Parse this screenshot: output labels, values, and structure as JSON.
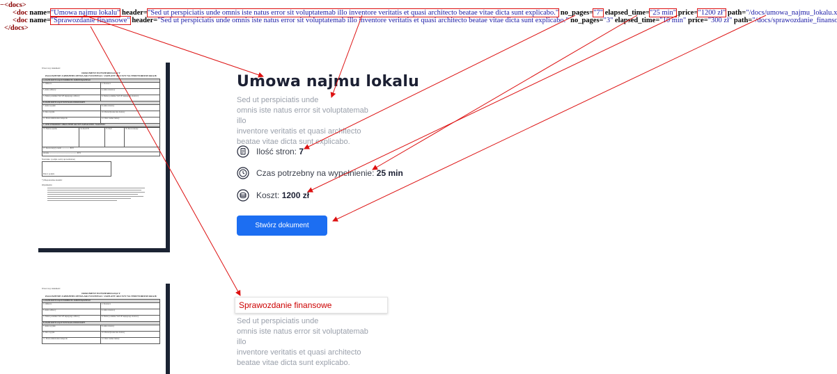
{
  "xml": {
    "minus": "−",
    "root_open": "<docs>",
    "root_close": "</docs>",
    "doc1": {
      "open": "<doc",
      "name_key": "name=",
      "name_val": "\"Umowa najmu lokalu\"",
      "header_key": "header=",
      "header_val": "\"Sed ut perspiciatis unde omnis iste natus error sit voluptatemab illo inventore veritatis et quasi architecto beatae vitae dicta sunt explicabo.\"",
      "pages_key": "no_pages=",
      "pages_val": "\"7\"",
      "time_key": "elapsed_time=",
      "time_val": "\"25 min\"",
      "price_key": "price=",
      "price_val": "\"1200 zł\"",
      "path_key": "path=",
      "path_val": "\"/docs/umowa_najmu_lokalu.xml\"",
      "close": "/>"
    },
    "doc2": {
      "open": "<doc",
      "name_key": "name=",
      "name_val": "\"Sprawozdanie finansowe\"",
      "header_key": "header=",
      "header_val": "\"Sed ut perspiciatis unde omnis iste natus error sit voluptatemab illo inventore veritatis et quasi architecto beatae vitae dicta sunt explicabo.\"",
      "pages_key": "no_pages=",
      "pages_val": "\"3\"",
      "time_key": "elapsed_time=",
      "time_val": "\"10 min\"",
      "price_key": "price=",
      "price_val": "\"300 zł\"",
      "path_key": "path=",
      "path_val": "\"/docs/sprawozdanie_finansowe.xml\"",
      "close": "/>"
    }
  },
  "thumbnail": {
    "intro": "Wzorcowy dokument:",
    "heading1": "DOKUMENT POTWIERDZAJĄCY",
    "heading2": "ZGŁOSZENIE ZABEZPIECZENIA AKCYZOWEGO / ZAPŁATY AKCYZY NA TERYTORIUM KRAJU",
    "section_a": "A. DANE DOTYCZĄCE PODMIOTU ZOBOWIĄZANEGO",
    "row1_l": "1. Odbiorca",
    "row1_r": "2. Dostawca",
    "row2_l": "3. Adres odbiorcy",
    "row2_r": "4. Adres dostawcy",
    "row3_l": "5. Numer podatnika VAT UE kupującego odbiorcy",
    "row3_r": "6. Numer podatnika VAT UE kupującego dostawcy",
    "section_b": "B. DANE DOTYCZĄCE WYSYŁKI LUB DOSTAWY",
    "row4_l": "7. Adres wysyłki",
    "row4_r": "8. Adres dostawy",
    "row5_l": "9. Data wysyłki",
    "row5_r": "10. Przewidywana data dostawy",
    "row6_l": "11. Przewoźnik/środek transportu",
    "row6_r": "12. Data i numer faktury",
    "section_c": "C. OPIS WYROBÓW I OBLICZENIE AKCYZY ZAPŁACONEJ / NALEŻNEJ",
    "col1": "13. Nazwa wyrobu",
    "col2": "14. Kod CN",
    "col3": "15. Ilość",
    "col4": "16. Kwota akcyzy",
    "total": "17. Kwota akcyzy razem .................. PLN",
    "words": "słownie ............................................................. PLN",
    "signature": "Nazwisko i podpis osoby upoważnionej",
    "date": "Data i podpis",
    "note": "*) Niepotrzebne skreślić",
    "objasnienia": "Objaśnienia:"
  },
  "doc1": {
    "title": "Umowa najmu lokalu",
    "desc_line1": "Sed ut perspiciatis unde",
    "desc_line2": "omnis iste natus error sit voluptatemab illo",
    "desc_line3": "inventore veritatis et quasi architecto",
    "desc_line4": "beatae vitae dicta sunt explicabo.",
    "pages_label": "Ilość stron:",
    "pages_value": "7",
    "time_label": "Czas potrzebny na wypełnienie:",
    "time_value": "25 min",
    "price_label": "Koszt:",
    "price_value": "1200 zł",
    "button": "Stwórz dokument"
  },
  "doc2": {
    "title": "Sprawozdanie finansowe",
    "desc_line1": "Sed ut perspiciatis unde",
    "desc_line2": "omnis iste natus error sit voluptatemab illo",
    "desc_line3": "inventore veritatis et quasi architecto",
    "desc_line4": "beatae vitae dicta sunt explicabo."
  },
  "icons": {
    "pages": "document-icon",
    "time": "clock-icon",
    "price": "coins-icon"
  },
  "colors": {
    "accent": "#1c6ef2",
    "annotation": "#d11111",
    "title": "#1c2033",
    "muted": "#9aa0ab",
    "xml_value": "#1a1aa6",
    "xml_tag": "#880000"
  }
}
